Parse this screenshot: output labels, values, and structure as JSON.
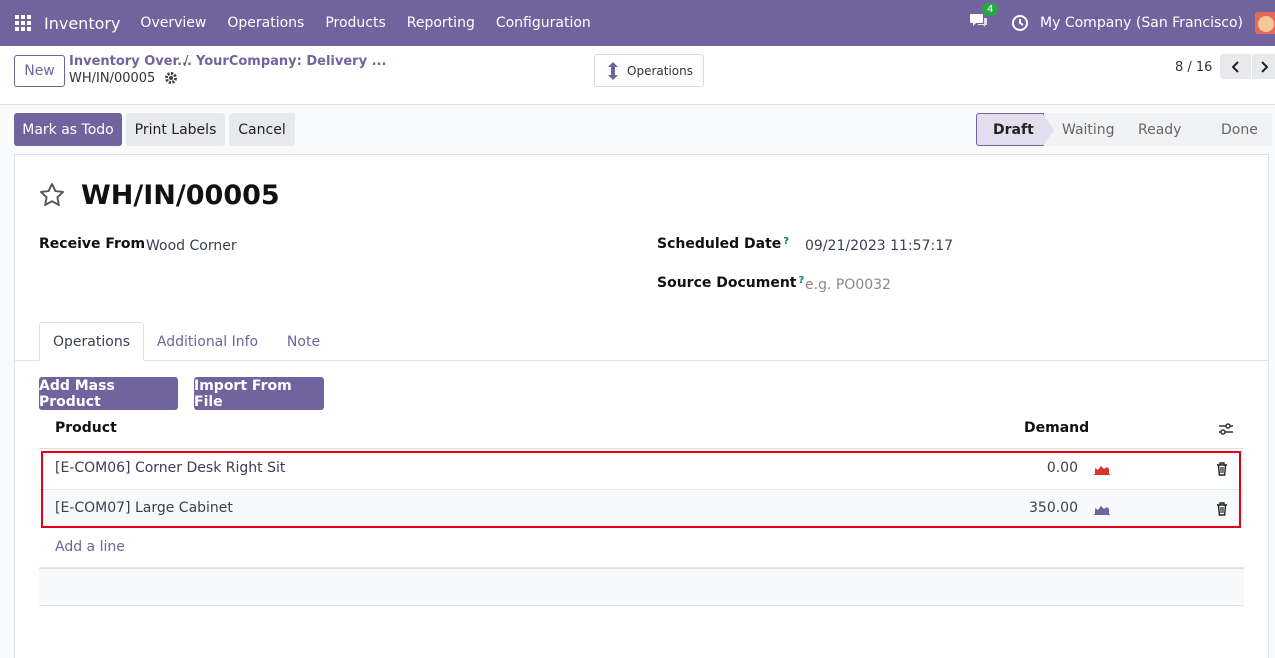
{
  "navbar": {
    "app_name": "Inventory",
    "menu": [
      "Overview",
      "Operations",
      "Products",
      "Reporting",
      "Configuration"
    ],
    "chat_count": "4",
    "company": "My Company (San Francisco)"
  },
  "control": {
    "new_label": "New",
    "breadcrumb_1": "Inventory Over...",
    "breadcrumb_sep": "/",
    "breadcrumb_2": "YourCompany: Delivery ...",
    "record_name": "WH/IN/00005",
    "operations_button": "Operations",
    "pager": "8 / 16"
  },
  "status_bar": {
    "buttons": [
      "Mark as Todo",
      "Print Labels",
      "Cancel"
    ],
    "stages": [
      "Draft",
      "Waiting",
      "Ready",
      "Done"
    ],
    "active_stage": "Draft"
  },
  "form": {
    "title": "WH/IN/00005",
    "receive_from_label": "Receive From",
    "receive_from_value": "Wood Corner",
    "scheduled_date_label": "Scheduled Date",
    "scheduled_date_value": "09/21/2023 11:57:17",
    "source_document_label": "Source Document",
    "source_document_placeholder": "e.g. PO0032",
    "help_mark": "?"
  },
  "tabs": [
    "Operations",
    "Additional Info",
    "Note"
  ],
  "actions": {
    "add_mass_product": "Add Mass Product",
    "import_from_file": "Import From File"
  },
  "table": {
    "columns": [
      "Product",
      "Demand"
    ],
    "rows": [
      {
        "product": "[E-COM06] Corner Desk Right Sit",
        "demand": "0.00",
        "forecast_color": "#d9342b"
      },
      {
        "product": "[E-COM07] Large Cabinet",
        "demand": "350.00",
        "forecast_color": "#71639e"
      }
    ],
    "add_line": "Add a line"
  },
  "colors": {
    "brand": "#71639e",
    "highlight": "#e0001a"
  }
}
